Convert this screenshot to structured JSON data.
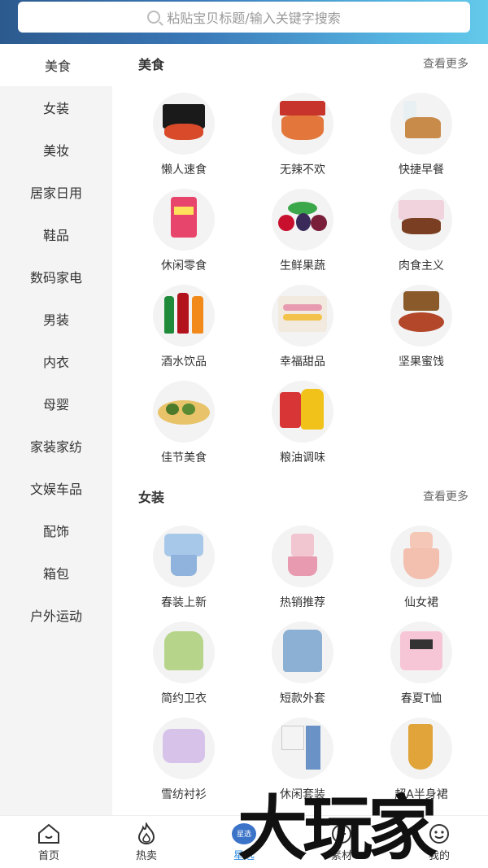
{
  "search": {
    "placeholder": "粘贴宝贝标题/输入关键字搜索"
  },
  "sidebar": {
    "items": [
      "美食",
      "女装",
      "美妆",
      "居家日用",
      "鞋品",
      "数码家电",
      "男装",
      "内衣",
      "母婴",
      "家装家纺",
      "文娱车品",
      "配饰",
      "箱包",
      "户外运动"
    ]
  },
  "sections": [
    {
      "title": "美食",
      "more": "查看更多",
      "items": [
        {
          "label": "懒人速食",
          "icon": "instant-noodle-icon"
        },
        {
          "label": "无辣不欢",
          "icon": "spicy-snack-icon"
        },
        {
          "label": "快捷早餐",
          "icon": "bread-icon"
        },
        {
          "label": "休闲零食",
          "icon": "snack-bag-icon"
        },
        {
          "label": "生鲜果蔬",
          "icon": "fruit-icon"
        },
        {
          "label": "肉食主义",
          "icon": "meat-icon"
        },
        {
          "label": "酒水饮品",
          "icon": "drink-bottles-icon"
        },
        {
          "label": "幸福甜品",
          "icon": "macaron-icon"
        },
        {
          "label": "坚果蜜饯",
          "icon": "nuts-icon"
        },
        {
          "label": "佳节美食",
          "icon": "festival-food-icon"
        },
        {
          "label": "粮油调味",
          "icon": "oil-rice-icon"
        }
      ]
    },
    {
      "title": "女装",
      "more": "查看更多",
      "items": [
        {
          "label": "春装上新",
          "icon": "blouse-icon"
        },
        {
          "label": "热销推荐",
          "icon": "pink-set-icon"
        },
        {
          "label": "仙女裙",
          "icon": "fairy-dress-icon"
        },
        {
          "label": "简约卫衣",
          "icon": "hoodie-icon"
        },
        {
          "label": "短款外套",
          "icon": "denim-jacket-icon"
        },
        {
          "label": "春夏T恤",
          "icon": "tshirt-icon"
        },
        {
          "label": "雪纺衬衫",
          "icon": "chiffon-shirt-icon"
        },
        {
          "label": "休闲套装",
          "icon": "casual-set-icon"
        },
        {
          "label": "超A半身裙",
          "icon": "skirt-icon"
        }
      ]
    }
  ],
  "tabbar": {
    "items": [
      {
        "label": "首页",
        "icon": "home-icon"
      },
      {
        "label": "热卖",
        "icon": "flame-icon"
      },
      {
        "label": "星选",
        "icon": "star-select-icon",
        "badge": "星选",
        "active": true
      },
      {
        "label": "素材",
        "icon": "material-icon"
      },
      {
        "label": "我的",
        "icon": "profile-icon"
      }
    ]
  },
  "watermark": "大玩家",
  "colors": {
    "accent": "#2f8de4",
    "sidebar_bg": "#f4f4f4"
  }
}
